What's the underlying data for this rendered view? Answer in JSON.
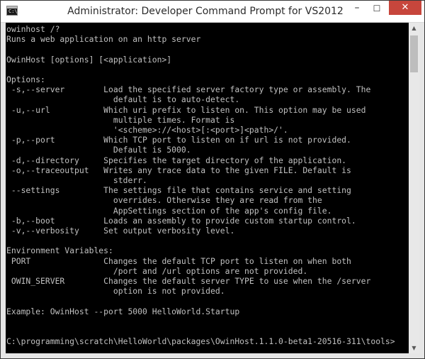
{
  "window": {
    "title": "Administrator: Developer Command Prompt for VS2012",
    "icon_text": "C:\\.",
    "icons": {
      "app": "console-icon",
      "minimize": "minimize-icon",
      "maximize": "maximize-icon",
      "close": "close-icon"
    }
  },
  "controls": {
    "minimize_glyph": "–",
    "maximize_glyph": "☐",
    "close_glyph": "✕"
  },
  "console": {
    "background": "#000000",
    "foreground": "#c0c0c0",
    "lines": [
      "owinhost /?",
      "Runs a web application on an http server",
      "",
      "OwinHost [options] [<application>]",
      "",
      "Options:",
      " -s,--server        Load the specified server factory type or assembly. The",
      "                      default is to auto-detect.",
      " -u,--url           Which uri prefix to listen on. This option may be used",
      "                      multiple times. Format is",
      "                      '<scheme>://<host>[:<port>]<path>/'.",
      " -p,--port          Which TCP port to listen on if url is not provided.",
      "                      Default is 5000.",
      " -d,--directory     Specifies the target directory of the application.",
      " -o,--traceoutput   Writes any trace data to the given FILE. Default is",
      "                      stderr.",
      " --settings         The settings file that contains service and setting",
      "                      overrides. Otherwise they are read from the",
      "                      AppSettings section of the app's config file.",
      " -b,--boot          Loads an assembly to provide custom startup control.",
      " -v,--verbosity     Set output verbosity level.",
      "",
      "Environment Variables:",
      " PORT               Changes the default TCP port to listen on when both",
      "                      /port and /url options are not provided.",
      " OWIN_SERVER        Changes the default server TYPE to use when the /server",
      "                      option is not provided.",
      "",
      "Example: OwinHost --port 5000 HelloWorld.Startup",
      "",
      "",
      "C:\\programming\\scratch\\HelloWorld\\packages\\OwinHost.1.1.0-beta1-20516-311\\tools>"
    ]
  },
  "scrollbar": {
    "up_glyph": "▲",
    "down_glyph": "▼"
  }
}
